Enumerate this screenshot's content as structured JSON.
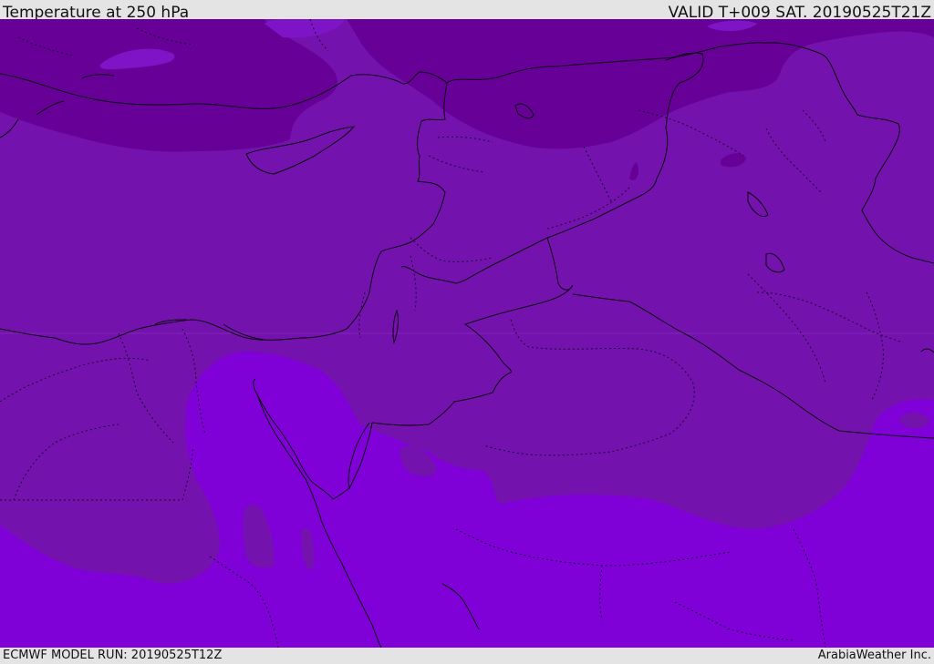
{
  "header": {
    "title": "Temperature at 250 hPa",
    "valid": "VALID T+009 SAT. 20190525T21Z"
  },
  "footer": {
    "model_run": "ECMWF MODEL RUN: 20190525T12Z",
    "credit": "ArabiaWeather Inc."
  },
  "colors": {
    "cold": "#660096",
    "mid": "#7412ad",
    "warm": "#8000d8",
    "mid_overlay": "#7d15c6",
    "coastline": "#0a0010"
  }
}
